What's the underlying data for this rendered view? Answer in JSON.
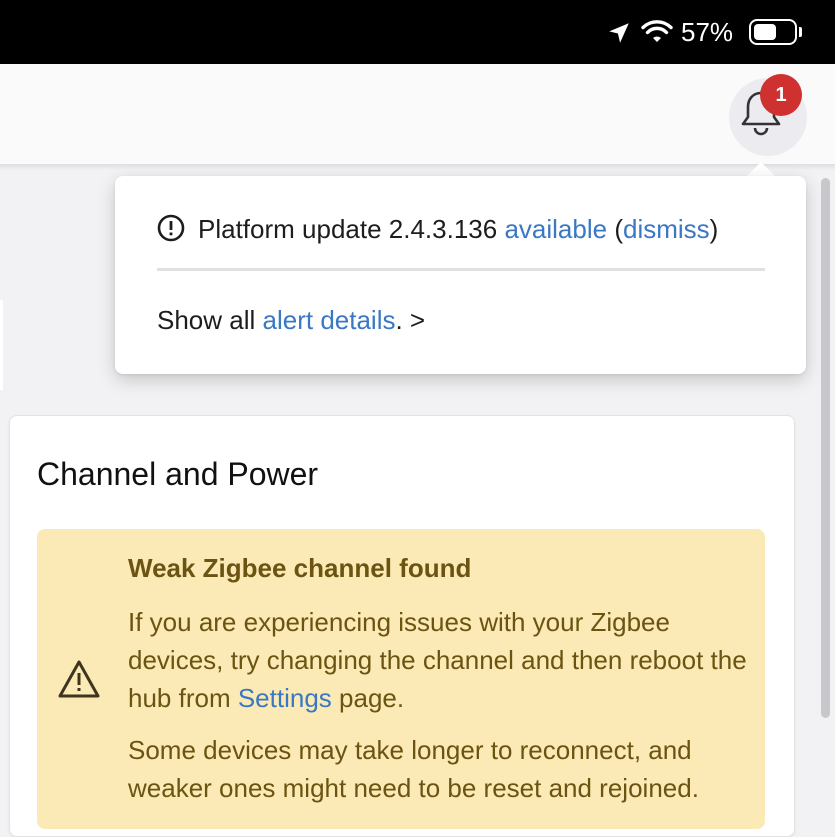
{
  "status_bar": {
    "battery_percent": "57%",
    "location_icon": "location-arrow-icon",
    "wifi_icon": "wifi-icon",
    "battery_icon": "battery-icon",
    "battery_level": 0.57
  },
  "header": {
    "bell_icon": "bell-icon",
    "notification_count": "1",
    "badge_color": "#cf3030"
  },
  "notifications_popover": {
    "alert": {
      "icon": "exclamation-circle-icon",
      "text_before": "Platform update 2.4.3.136",
      "available_link": "available",
      "paren_open": "(",
      "dismiss_link": "dismiss",
      "paren_close": ")"
    },
    "footer": {
      "prefix": "Show all",
      "link": "alert details",
      "suffix": ". >"
    }
  },
  "card": {
    "title": "Channel and Power",
    "warning": {
      "icon": "warning-triangle-icon",
      "title": "Weak Zigbee channel found",
      "body_1_before": "If you are experiencing issues with your Zigbee devices, try changing the channel and then reboot the hub from",
      "body_1_link": "Settings",
      "body_1_after": "page.",
      "body_2": "Some devices may take longer to reconnect, and weaker ones might need to be reset and rejoined."
    }
  },
  "colors": {
    "link": "#3a78c4",
    "warning_bg": "#fbeab5",
    "warning_text": "#6b5412"
  }
}
